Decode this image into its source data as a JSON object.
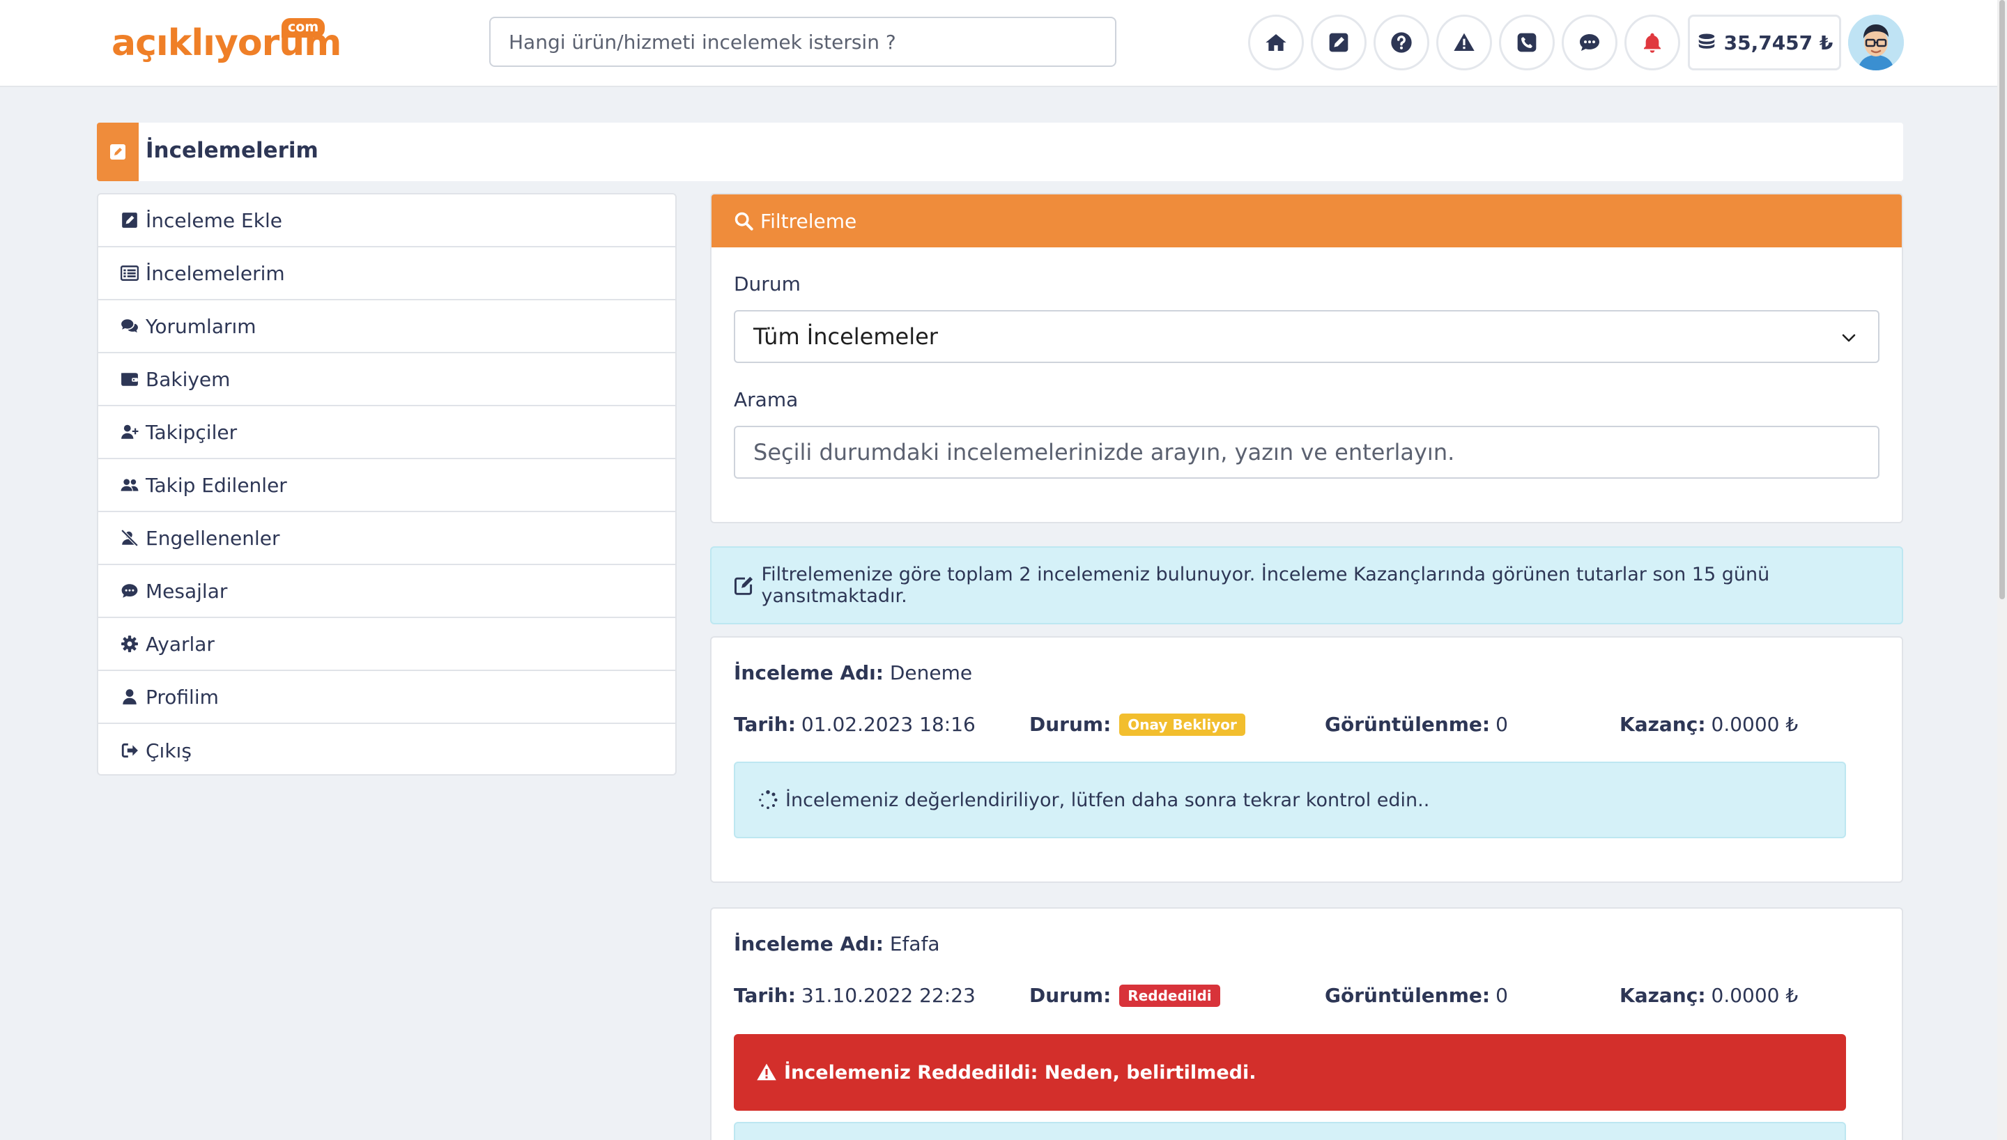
{
  "header": {
    "logo": {
      "word": "açıklıyorum",
      "suffix": "com"
    },
    "search_placeholder": "Hangi ürün/hizmeti incelemek istersin ?",
    "icons": [
      "home-icon",
      "edit-icon",
      "question-icon",
      "warning-icon",
      "phone-icon",
      "chat-icon",
      "bell-icon"
    ],
    "balance": "35,7457 ₺"
  },
  "page": {
    "title": "İncelemelerim"
  },
  "sidebar": {
    "items": [
      {
        "label": "İnceleme Ekle",
        "icon": "edit-icon"
      },
      {
        "label": "İncelemelerim",
        "icon": "list-icon"
      },
      {
        "label": "Yorumlarım",
        "icon": "comments-icon"
      },
      {
        "label": "Bakiyem",
        "icon": "wallet-icon"
      },
      {
        "label": "Takipçiler",
        "icon": "user-plus-icon"
      },
      {
        "label": "Takip Edilenler",
        "icon": "users-icon"
      },
      {
        "label": "Engellenenler",
        "icon": "user-slash-icon"
      },
      {
        "label": "Mesajlar",
        "icon": "message-icon"
      },
      {
        "label": "Ayarlar",
        "icon": "gear-icon"
      },
      {
        "label": "Profilim",
        "icon": "user-icon"
      },
      {
        "label": "Çıkış",
        "icon": "sign-out-icon"
      }
    ]
  },
  "filter": {
    "header": "Filtreleme",
    "status_label": "Durum",
    "status_value": "Tüm İncelemeler",
    "search_label": "Arama",
    "search_placeholder": "Seçili durumdaki incelemelerinizde arayın, yazın ve enterlayın."
  },
  "info": "Filtrelemenize göre toplam 2 incelemeniz bulunuyor. İnceleme Kazançlarında görünen tutarlar son 15 günü yansıtmaktadır.",
  "labels": {
    "name": "İnceleme Adı:",
    "date": "Tarih:",
    "status": "Durum:",
    "views": "Görüntülenme:",
    "earnings": "Kazanç:"
  },
  "reviews": [
    {
      "name": "Deneme",
      "date": "01.02.2023 18:16",
      "status": "Onay Bekliyor",
      "status_color": "#f2be2e",
      "views": "0",
      "earnings": "0.0000 ₺",
      "message": "İncelemeniz değerlendiriliyor, lütfen daha sonra tekrar kontrol edin.."
    },
    {
      "name": "Efafa",
      "date": "31.10.2022 22:23",
      "status": "Reddedildi",
      "status_color": "#d8333a",
      "views": "0",
      "earnings": "0.0000 ₺",
      "message": "İncelemeniz Reddedildi: Neden, belirtilmedi."
    }
  ]
}
